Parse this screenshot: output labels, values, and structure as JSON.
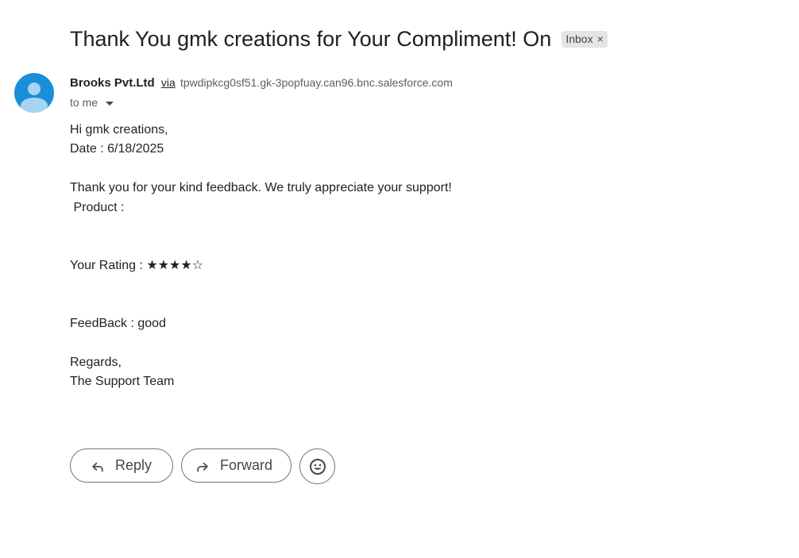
{
  "subject": "Thank You gmk creations for Your Compliment! On",
  "label_chip": {
    "text": "Inbox",
    "remove_glyph": "×"
  },
  "sender": {
    "name": "Brooks Pvt.Ltd",
    "via": "via",
    "via_address": "tpwdipkcg0sf51.gk-3popfuay.can96.bnc.salesforce.com",
    "recipient": "to me"
  },
  "avatar": {
    "icon": "person-icon",
    "color": "#1a8fd8"
  },
  "body": {
    "greeting": "Hi gmk creations,",
    "date": "Date : 6/18/2025",
    "thanks": "Thank you for your kind feedback. We truly appreciate your support!",
    "product": " Product :",
    "rating": "Your Rating : ★★★★☆",
    "feedback": "FeedBack : good",
    "regards": "Regards,",
    "signature": "The Support Team"
  },
  "actions": {
    "reply_label": "Reply",
    "forward_label": "Forward",
    "reply_icon": "reply-icon",
    "forward_icon": "forward-icon",
    "emoji_icon": "emoji-icon"
  }
}
